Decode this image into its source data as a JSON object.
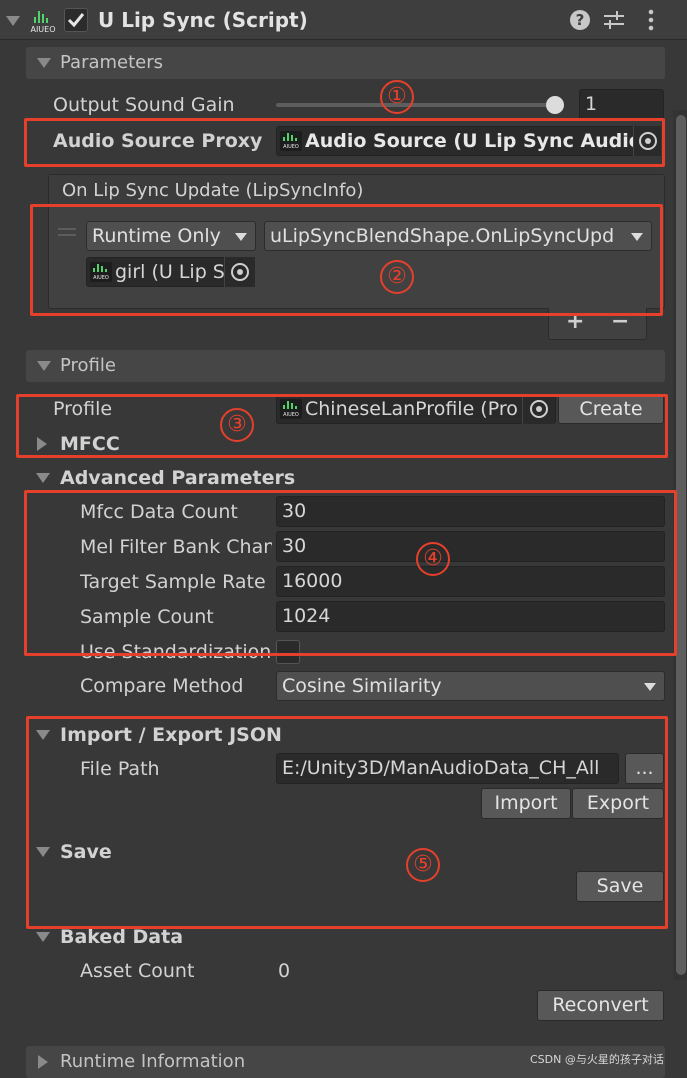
{
  "header": {
    "component_title": "U Lip Sync (Script)",
    "enabled": true,
    "help_icon": "help-icon",
    "settings_icon": "preset-sliders-icon",
    "menu_icon": "kebab-menu-icon"
  },
  "icon_text": "AIUEO",
  "parameters": {
    "section_title": "Parameters",
    "output_gain_label": "Output Sound Gain",
    "output_gain_value": "1",
    "output_gain_slider": 1.0,
    "audio_source_proxy_label": "Audio Source Proxy",
    "audio_source_proxy_value": "Audio Source (U Lip Sync Audio S",
    "event_title": "On Lip Sync Update (LipSyncInfo)",
    "event_runtime": "Runtime Only",
    "event_function": "uLipSyncBlendShape.OnLipSyncUpd",
    "event_target": "girl (U Lip S",
    "add_label": "+",
    "remove_label": "−"
  },
  "profile": {
    "section_title": "Profile",
    "profile_label": "Profile",
    "profile_value": "ChineseLanProfile (Pro",
    "create_label": "Create",
    "mfcc_label": "MFCC",
    "advanced_label": "Advanced Parameters",
    "mfcc_data_count_label": "Mfcc Data Count",
    "mfcc_data_count_value": "30",
    "mel_filter_label": "Mel Filter Bank Chan",
    "mel_filter_value": "30",
    "target_rate_label": "Target Sample Rate",
    "target_rate_value": "16000",
    "sample_count_label": "Sample Count",
    "sample_count_value": "1024",
    "use_standardization_label": "Use Standardization",
    "use_standardization_checked": false,
    "compare_method_label": "Compare Method",
    "compare_method_value": "Cosine Similarity"
  },
  "import_export": {
    "section_label": "Import / Export JSON",
    "file_path_label": "File Path",
    "file_path_value": "E:/Unity3D/ManAudioData_CH_All",
    "browse_label": "...",
    "import_label": "Import",
    "export_label": "Export"
  },
  "save": {
    "section_label": "Save",
    "save_label": "Save"
  },
  "baked": {
    "section_label": "Baked Data",
    "asset_count_label": "Asset Count",
    "asset_count_value": "0",
    "reconvert_label": "Reconvert"
  },
  "runtime": {
    "section_title": "Runtime Information"
  },
  "annotations": [
    "①",
    "②",
    "③",
    "④",
    "⑤"
  ],
  "watermark": "CSDN @与火星的孩子对话",
  "colors": {
    "annotation_red": "#e5402c",
    "background": "#383838",
    "field": "#2a2a2a",
    "icon_green": "#4fd36a"
  }
}
